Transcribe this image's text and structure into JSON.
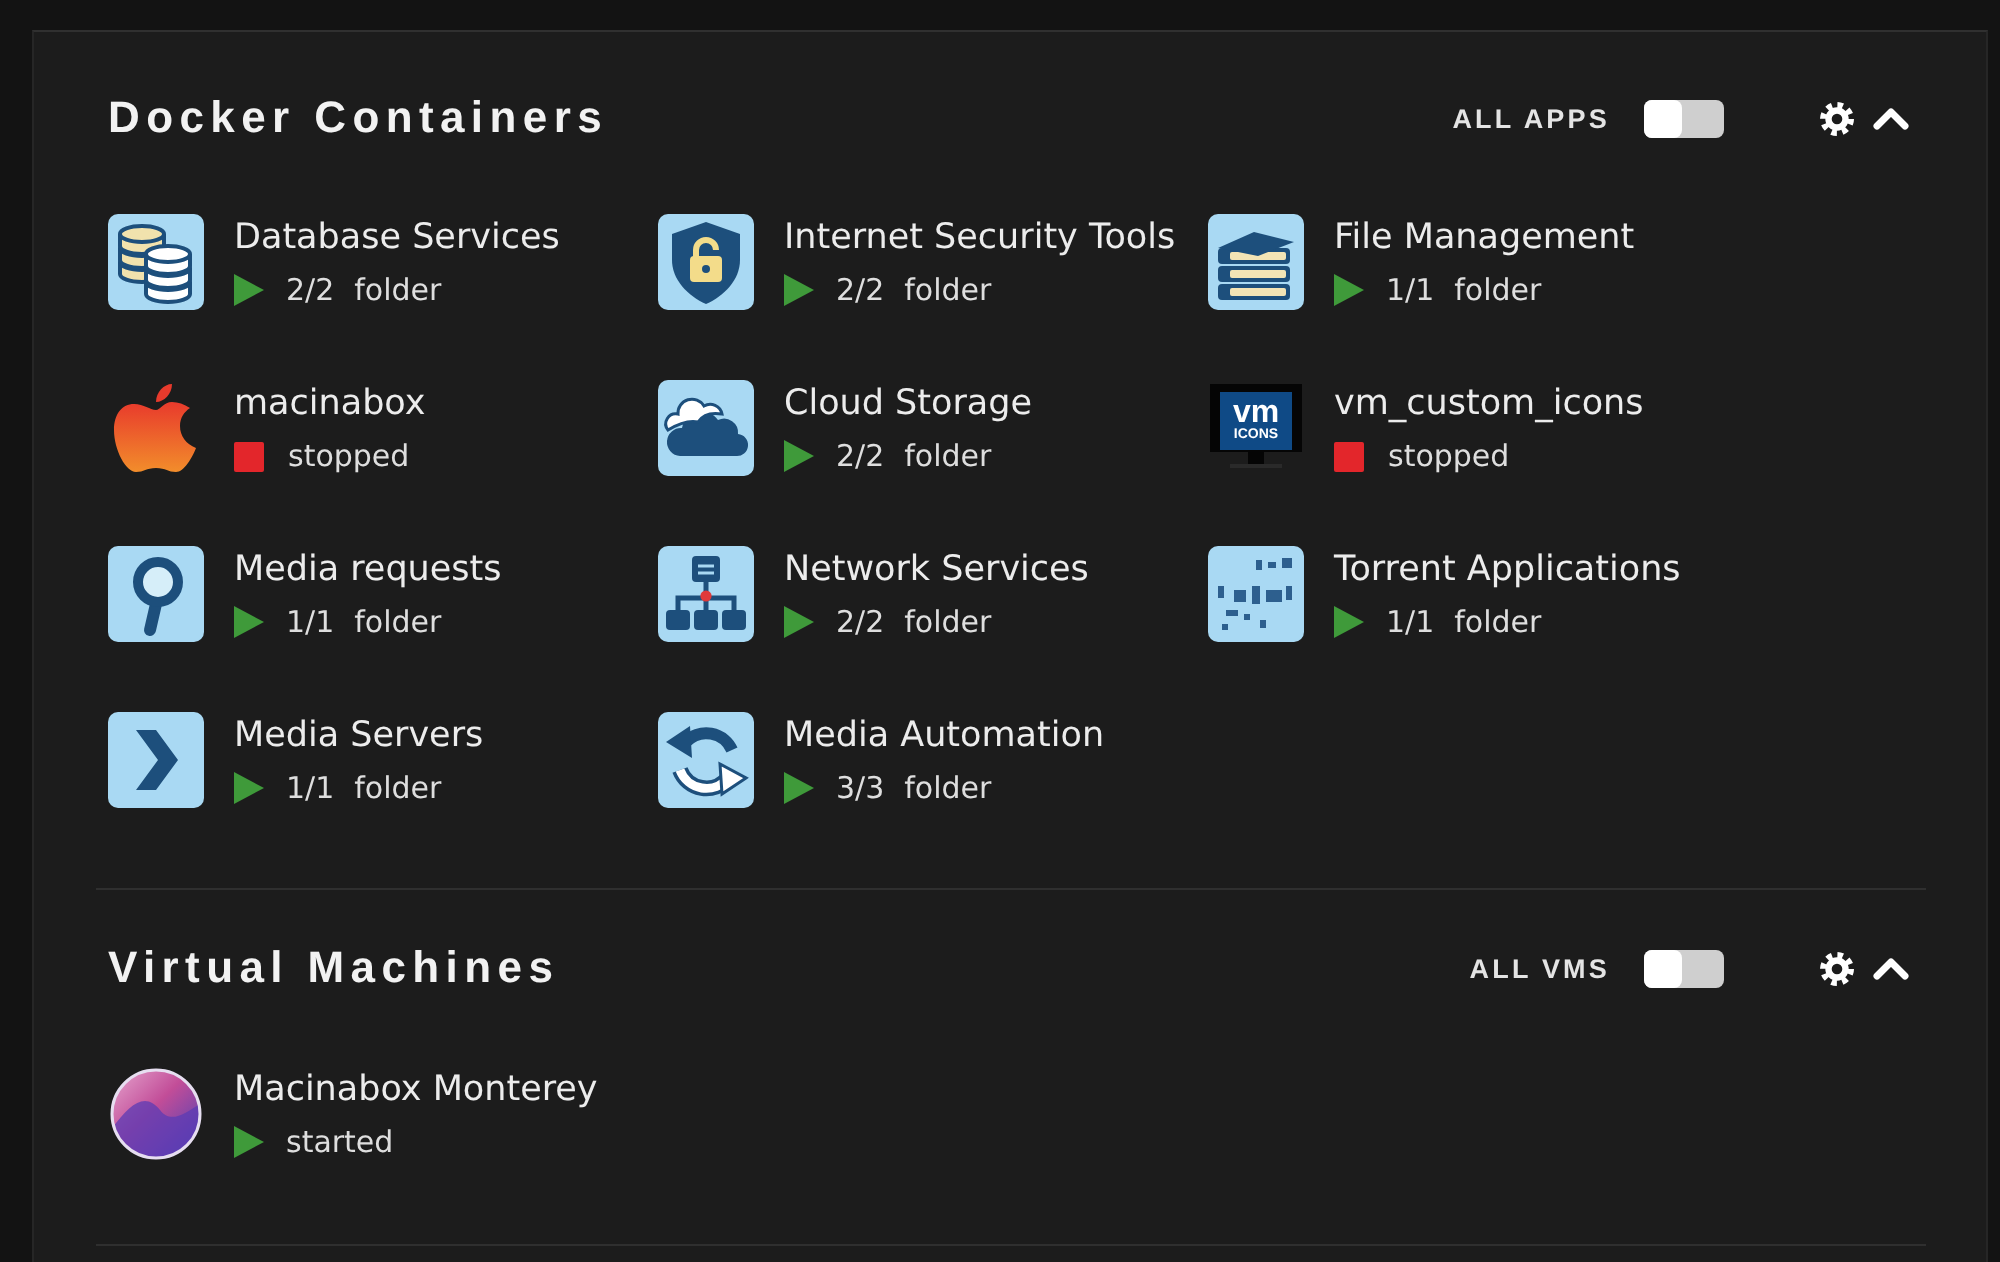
{
  "sections": [
    {
      "title": "Docker Containers",
      "toggle": {
        "label": "ALL APPS",
        "on": false
      },
      "expanded": true,
      "items": [
        {
          "name": "Database Services",
          "kind": "database",
          "running": true,
          "count": "2/2",
          "type": "folder"
        },
        {
          "name": "Internet Security Tools",
          "kind": "shield",
          "running": true,
          "count": "2/2",
          "type": "folder"
        },
        {
          "name": "File Management",
          "kind": "books",
          "running": true,
          "count": "1/1",
          "type": "folder"
        },
        {
          "name": "macinabox",
          "kind": "apple",
          "running": false,
          "status_label": "stopped"
        },
        {
          "name": "Cloud Storage",
          "kind": "cloud",
          "running": true,
          "count": "2/2",
          "type": "folder"
        },
        {
          "name": "vm_custom_icons",
          "kind": "monitor",
          "logo": [
            "vm",
            "ICONS"
          ],
          "running": false,
          "status_label": "stopped"
        },
        {
          "name": "Media requests",
          "kind": "magnifier",
          "running": true,
          "count": "1/1",
          "type": "folder"
        },
        {
          "name": "Network Services",
          "kind": "network",
          "running": true,
          "count": "2/2",
          "type": "folder"
        },
        {
          "name": "Torrent Applications",
          "kind": "pattern",
          "running": true,
          "count": "1/1",
          "type": "folder"
        },
        {
          "name": "Media Servers",
          "kind": "chevron",
          "running": true,
          "count": "1/1",
          "type": "folder"
        },
        {
          "name": "Media Automation",
          "kind": "sync",
          "running": true,
          "count": "3/3",
          "type": "folder"
        }
      ]
    },
    {
      "title": "Virtual Machines",
      "toggle": {
        "label": "ALL VMS",
        "on": false
      },
      "expanded": true,
      "items": [
        {
          "name": "Macinabox Monterey",
          "kind": "disc",
          "running": true,
          "status_label": "started"
        }
      ]
    }
  ]
}
